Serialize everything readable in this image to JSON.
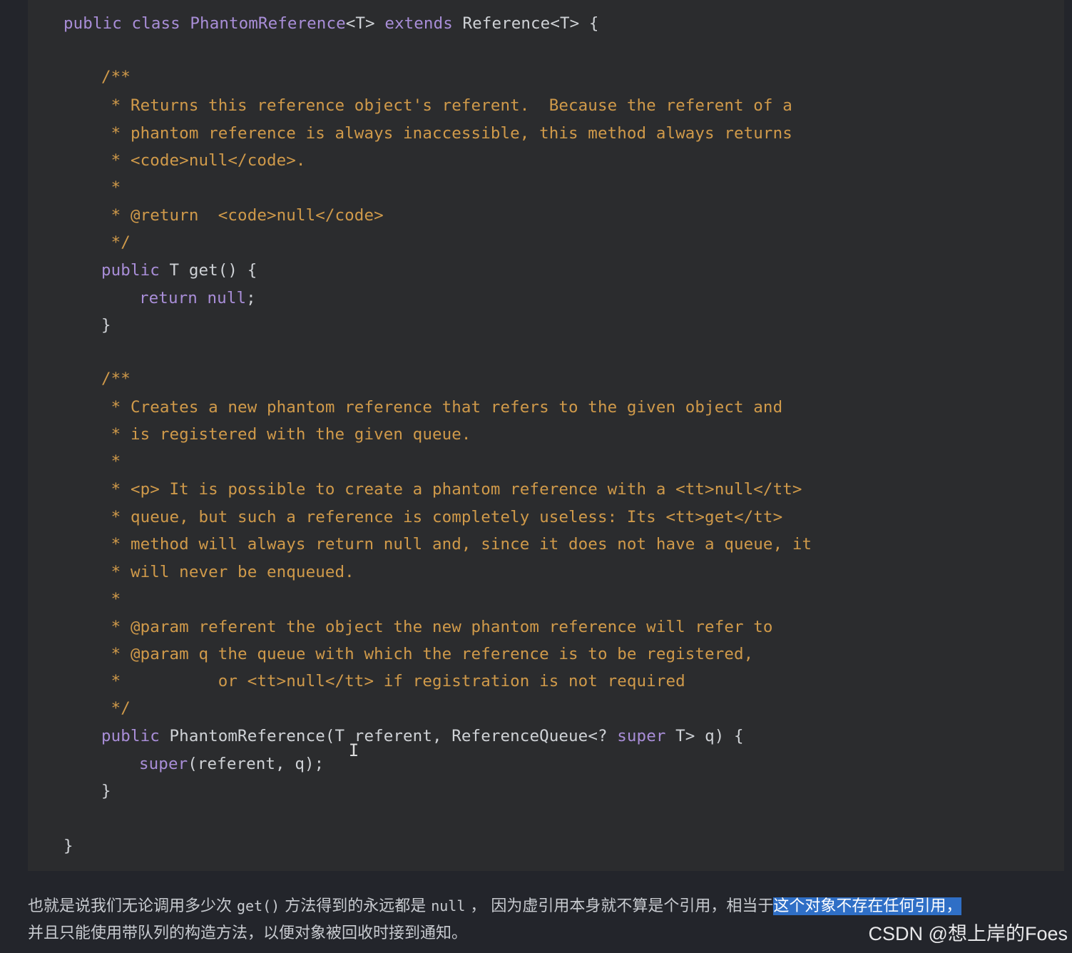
{
  "code": {
    "lines": [
      [
        {
          "c": "kw",
          "t": "public class "
        },
        {
          "c": "cls",
          "t": "PhantomReference"
        },
        {
          "c": "plain",
          "t": "<T> "
        },
        {
          "c": "kw",
          "t": "extends "
        },
        {
          "c": "plain",
          "t": "Reference<T> {"
        }
      ],
      [
        {
          "c": "cm",
          "t": "/**"
        }
      ],
      [
        {
          "c": "cm",
          "t": " * Returns this reference object's referent.  Because the referent of a"
        }
      ],
      [
        {
          "c": "cm",
          "t": " * phantom reference is always inaccessible, this method always returns"
        }
      ],
      [
        {
          "c": "cm",
          "t": " * <code>null</code>."
        }
      ],
      [
        {
          "c": "cm",
          "t": " *"
        }
      ],
      [
        {
          "c": "cm",
          "t": " * @return  <code>null</code>"
        }
      ],
      [
        {
          "c": "cm",
          "t": " */"
        }
      ],
      [
        {
          "c": "kw",
          "t": "public "
        },
        {
          "c": "plain",
          "t": "T get() {"
        }
      ],
      [
        {
          "c": "kw",
          "t": "return null"
        },
        {
          "c": "plain",
          "t": ";"
        }
      ],
      [
        {
          "c": "plain",
          "t": "}"
        }
      ],
      [
        {
          "c": "cm",
          "t": "/**"
        }
      ],
      [
        {
          "c": "cm",
          "t": " * Creates a new phantom reference that refers to the given object and"
        }
      ],
      [
        {
          "c": "cm",
          "t": " * is registered with the given queue."
        }
      ],
      [
        {
          "c": "cm",
          "t": " *"
        }
      ],
      [
        {
          "c": "cm",
          "t": " * <p> It is possible to create a phantom reference with a <tt>null</tt>"
        }
      ],
      [
        {
          "c": "cm",
          "t": " * queue, but such a reference is completely useless: Its <tt>get</tt>"
        }
      ],
      [
        {
          "c": "cm",
          "t": " * method will always return null and, since it does not have a queue, it"
        }
      ],
      [
        {
          "c": "cm",
          "t": " * will never be enqueued."
        }
      ],
      [
        {
          "c": "cm",
          "t": " *"
        }
      ],
      [
        {
          "c": "cm",
          "t": " * @param referent the object the new phantom reference will refer to"
        }
      ],
      [
        {
          "c": "cm",
          "t": " * @param q the queue with which the reference is to be registered,"
        }
      ],
      [
        {
          "c": "cm",
          "t": " *          or <tt>null</tt> if registration is not required"
        }
      ],
      [
        {
          "c": "cm",
          "t": " */"
        }
      ],
      [
        {
          "c": "kw",
          "t": "public "
        },
        {
          "c": "plain",
          "t": "PhantomReference(T referent, ReferenceQueue<? "
        },
        {
          "c": "kw",
          "t": "super "
        },
        {
          "c": "plain",
          "t": "T> q) {"
        }
      ],
      [
        {
          "c": "kw",
          "t": "super"
        },
        {
          "c": "plain",
          "t": "(referent, q);"
        }
      ],
      [
        {
          "c": "plain",
          "t": "}"
        }
      ],
      [
        {
          "c": "plain",
          "t": "}"
        }
      ]
    ]
  },
  "text_cursor": "I",
  "paragraph": {
    "line1_a": "也就是说我们无论调用多少次 ",
    "line1_code1": "get()",
    "line1_b": " 方法得到的永远都是 ",
    "line1_code2": "null",
    "line1_c": " ， 因为虚引用本身就不算是个引用，相当于",
    "line1_highlight": "这个对象不存在任何引用，",
    "line2": "并且只能使用带队列的构造方法，以便对象被回收时接到通知。"
  },
  "watermark": "CSDN @想上岸的Foes"
}
